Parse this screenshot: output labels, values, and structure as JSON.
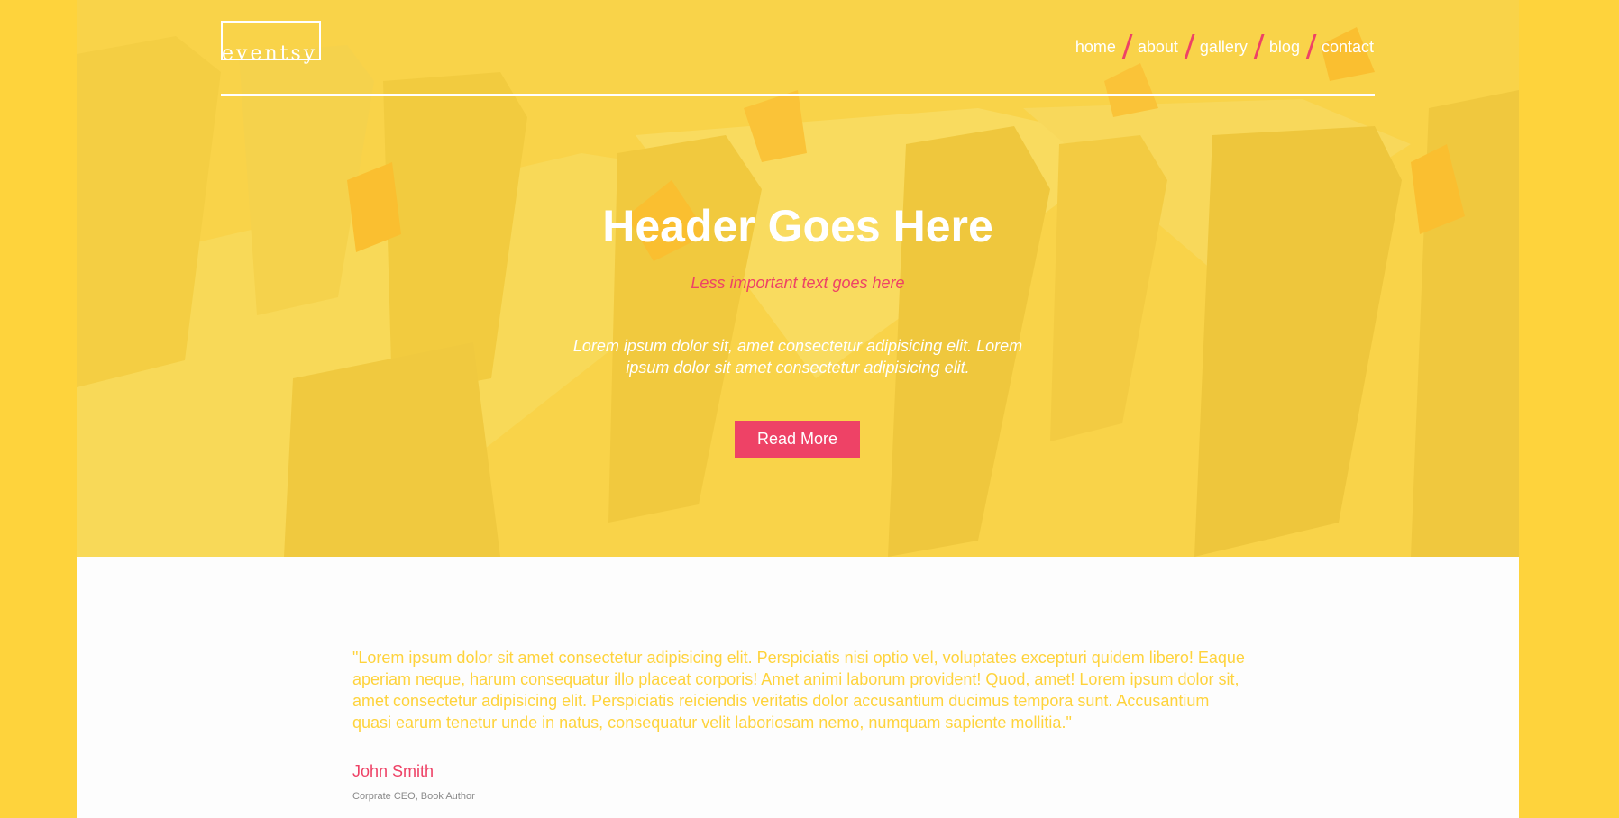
{
  "brand": {
    "logo_text": "eventsy"
  },
  "nav": {
    "items": [
      {
        "label": "home"
      },
      {
        "label": "about"
      },
      {
        "label": "gallery"
      },
      {
        "label": "blog"
      },
      {
        "label": "contact"
      }
    ]
  },
  "hero": {
    "title": "Header Goes Here",
    "subtitle": "Less important text goes here",
    "text": "Lorem ipsum dolor sit, amet consectetur adipisicing elit. Lorem ipsum dolor sit amet consectetur adipisicing elit.",
    "button_label": "Read More"
  },
  "testimonial": {
    "quote": "\"Lorem ipsum dolor sit amet consectetur adipisicing elit. Perspiciatis nisi optio vel, voluptates excepturi quidem libero! Eaque aperiam neque, harum consequatur illo placeat corporis! Amet animi laborum provident! Quod, amet! Lorem ipsum dolor sit, amet consectetur adipisicing elit. Perspiciatis reiciendis veritatis dolor accusantium ducimus tempora sunt. Accusantium quasi earum tenetur unde in natus, consequatur velit laboriosam nemo, numquam sapiente mollitia.\"",
    "author_name": "John Smith",
    "author_role": "Corprate CEO, Book Author"
  },
  "colors": {
    "primary_yellow": "#fed33c",
    "accent_pink": "#ee4266",
    "text_white": "#ffffff",
    "muted_gray": "#8a8a8a",
    "page_bg": "#fdfdfd"
  }
}
